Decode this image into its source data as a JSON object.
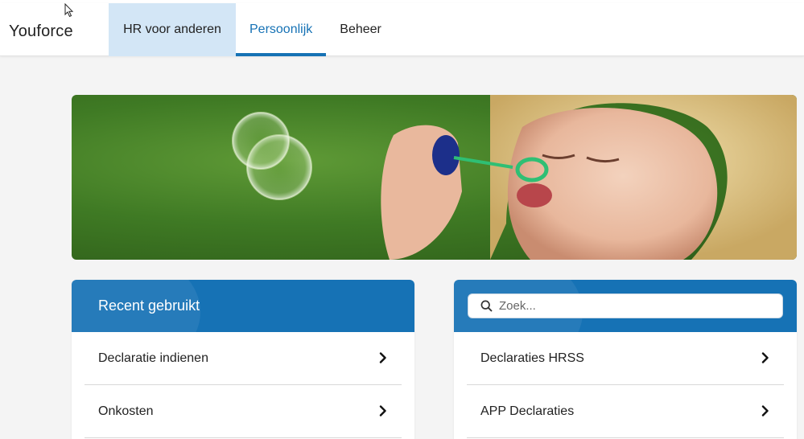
{
  "app": {
    "brand": "Youforce"
  },
  "nav": {
    "tabs": [
      {
        "label": "HR voor anderen"
      },
      {
        "label": "Persoonlijk"
      },
      {
        "label": "Beheer"
      }
    ],
    "active_tab": "Persoonlijk"
  },
  "colors": {
    "accent": "#1672b5",
    "hr_tab_bg": "#d3e6f6",
    "banner_green": "#3f7a24"
  },
  "banner": {
    "image": "child-blowing-soap-bubbles"
  },
  "recent": {
    "title": "Recent gebruikt",
    "items": [
      {
        "label": "Declaratie indienen"
      },
      {
        "label": "Onkosten"
      }
    ]
  },
  "search_panel": {
    "placeholder": "Zoek...",
    "items": [
      {
        "label": "Declaraties HRSS"
      },
      {
        "label": "APP Declaraties"
      }
    ]
  },
  "icons": {
    "search": "search-icon",
    "chevron": "chevron-right-icon",
    "cursor": "mouse-cursor-icon"
  }
}
